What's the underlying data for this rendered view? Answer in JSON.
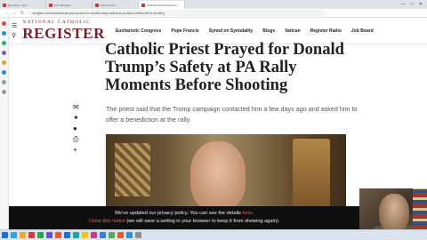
{
  "browser": {
    "tabs": [
      {
        "label": "Be Home – Joh...",
        "active": false
      },
      {
        "label": "Fox: Wireless...",
        "active": false
      },
      {
        "label": "Fox's Home ...",
        "active": false
      },
      {
        "label": "Catholic Priest Prayed for ...",
        "active": true
      }
    ],
    "url": "ncregister.com/news/catholic-priest-prayed-for-donald-trumps-safety-at-pa-rally-moments-before-shooting"
  },
  "site": {
    "logo_sup": "NATIONAL CATHOLIC",
    "logo_main": "REGISTER",
    "nav": [
      "Eucharistic Congress",
      "Pope Francis",
      "Synod on Synodality",
      "Blogs",
      "Vatican",
      "Register Radio",
      "Job Board"
    ]
  },
  "article": {
    "headline": "Catholic Priest Prayed for Donald Trump’s Safety at PA Rally Moments Before Shooting",
    "subtitle": "The priest said that the Trump campaign contacted him a few days ago and asked him to offer a benediction at the rally."
  },
  "share_icons": [
    "email-icon",
    "twitter-icon",
    "facebook-icon",
    "print-icon",
    "plus-icon"
  ],
  "privacy": {
    "line1_prefix": "We've updated our privacy policy. You can see the details ",
    "line1_link": "here",
    "line1_suffix": ".",
    "line2_link": "Close this notice",
    "line2_suffix": " (we will save a setting in your browser to keep it from showing again)."
  },
  "colors": {
    "brand": "#7b1f26",
    "privacy_bg": "#0f0f0f",
    "privacy_link": "#e86060"
  }
}
